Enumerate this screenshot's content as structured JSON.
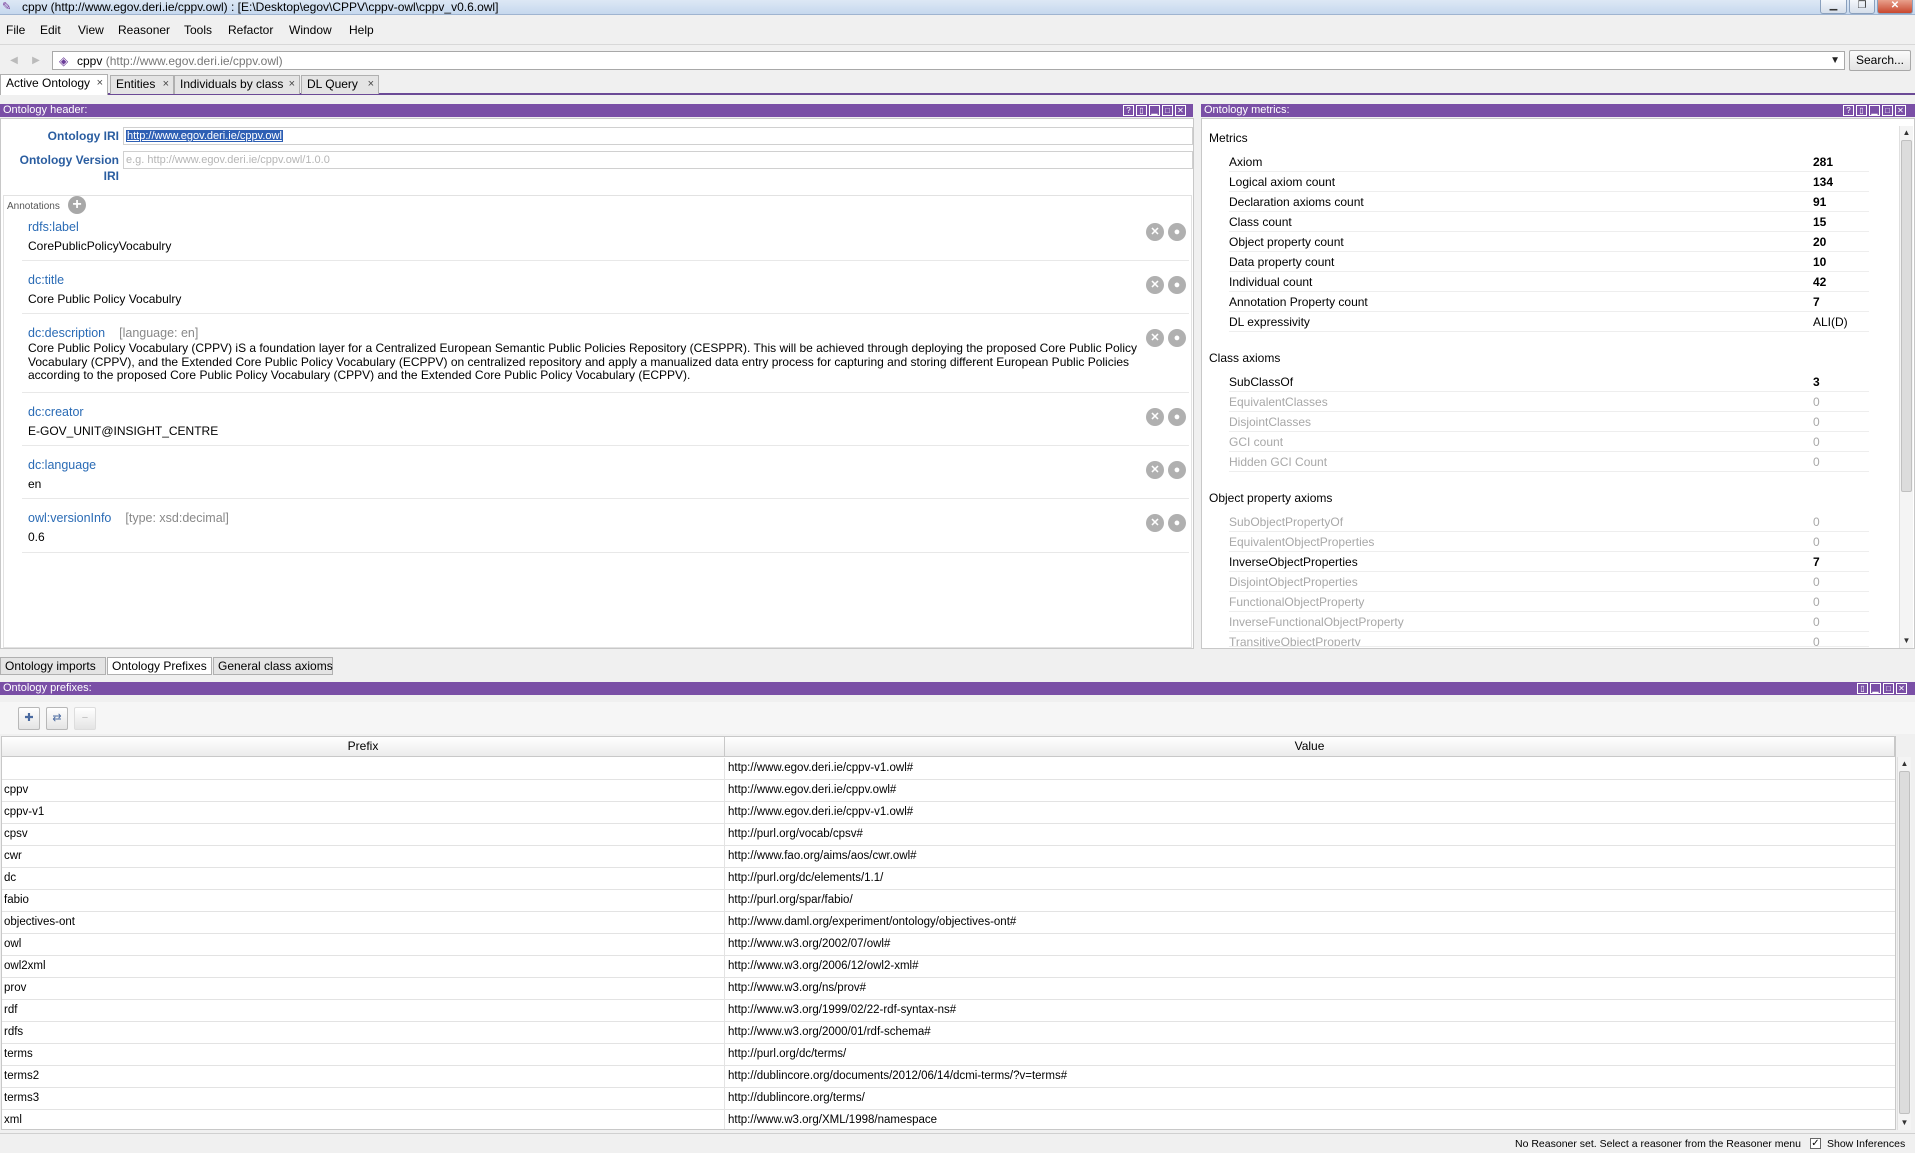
{
  "window": {
    "title": "cppv (http://www.egov.deri.ie/cppv.owl)  : [E:\\Desktop\\egov\\CPPV\\cppv-owl\\cppv_v0.6.owl]",
    "app_icon": "protege-icon",
    "controls": [
      "minimize",
      "maximize",
      "close"
    ]
  },
  "menu": [
    "File",
    "Edit",
    "View",
    "Reasoner",
    "Tools",
    "Refactor",
    "Window",
    "Help"
  ],
  "address": {
    "name": "cppv",
    "iri": "(http://www.egov.deri.ie/cppv.owl)",
    "search_label": "Search..."
  },
  "tabs": [
    {
      "label": "Active Ontology",
      "active": true
    },
    {
      "label": "Entities",
      "active": false
    },
    {
      "label": "Individuals by class",
      "active": false
    },
    {
      "label": "DL Query",
      "active": false
    }
  ],
  "header_panel": {
    "title": "Ontology header:",
    "iri_label": "Ontology IRI",
    "iri_value": "http://www.egov.deri.ie/cppv.owl",
    "version_label": "Ontology Version IRI",
    "version_placeholder": "e.g. http://www.egov.deri.ie/cppv.owl/1.0.0",
    "annotations_title": "Annotations",
    "annotations": [
      {
        "property": "rdfs:label",
        "qualifier": "",
        "value": "CorePublicPolicyVocabulry"
      },
      {
        "property": "dc:title",
        "qualifier": "",
        "value": "Core Public Policy Vocabulry"
      },
      {
        "property": "dc:description",
        "qualifier": "[language: en]",
        "value": "Core Public Policy Vocabulary (CPPV) iS a foundation layer for a Centralized European Semantic Public Policies Repository (CESPPR). This will be achieved through deploying the proposed Core Public Policy Vocabulary (CPPV), and the Extended Core Public Policy Vocabulary (ECPPV) on centralized repository and apply a manualized data entry process for capturing and storing different European Public Policies according to the proposed Core Public Policy Vocabulary (CPPV) and the Extended Core Public Policy Vocabulary (ECPPV)."
      },
      {
        "property": "dc:creator",
        "qualifier": "",
        "value": "E-GOV_UNIT@INSIGHT_CENTRE"
      },
      {
        "property": "dc:language",
        "qualifier": "",
        "value": "en"
      },
      {
        "property": "owl:versionInfo",
        "qualifier": "[type: xsd:decimal]",
        "value": "0.6"
      }
    ]
  },
  "metrics_panel": {
    "title": "Ontology metrics:",
    "sections": [
      {
        "title": "Metrics",
        "rows": [
          {
            "label": "Axiom",
            "value": "281",
            "dim": false
          },
          {
            "label": "Logical axiom count",
            "value": "134",
            "dim": false
          },
          {
            "label": "Declaration axioms count",
            "value": "91",
            "dim": false
          },
          {
            "label": "Class count",
            "value": "15",
            "dim": false
          },
          {
            "label": "Object property count",
            "value": "20",
            "dim": false
          },
          {
            "label": "Data property count",
            "value": "10",
            "dim": false
          },
          {
            "label": "Individual count",
            "value": "42",
            "dim": false
          },
          {
            "label": "Annotation Property count",
            "value": "7",
            "dim": false
          },
          {
            "label": "DL expressivity",
            "value": "ALI(D)",
            "dim": false,
            "plain": true
          }
        ]
      },
      {
        "title": "Class axioms",
        "rows": [
          {
            "label": "SubClassOf",
            "value": "3",
            "dim": false
          },
          {
            "label": "EquivalentClasses",
            "value": "0",
            "dim": true
          },
          {
            "label": "DisjointClasses",
            "value": "0",
            "dim": true
          },
          {
            "label": "GCI count",
            "value": "0",
            "dim": true
          },
          {
            "label": "Hidden GCI Count",
            "value": "0",
            "dim": true
          }
        ]
      },
      {
        "title": "Object property axioms",
        "rows": [
          {
            "label": "SubObjectPropertyOf",
            "value": "0",
            "dim": true
          },
          {
            "label": "EquivalentObjectProperties",
            "value": "0",
            "dim": true
          },
          {
            "label": "InverseObjectProperties",
            "value": "7",
            "dim": false
          },
          {
            "label": "DisjointObjectProperties",
            "value": "0",
            "dim": true
          },
          {
            "label": "FunctionalObjectProperty",
            "value": "0",
            "dim": true
          },
          {
            "label": "InverseFunctionalObjectProperty",
            "value": "0",
            "dim": true
          },
          {
            "label": "TransitiveObjectProperty",
            "value": "0",
            "dim": true
          }
        ]
      }
    ]
  },
  "subtabs": [
    {
      "label": "Ontology imports",
      "active": false
    },
    {
      "label": "Ontology Prefixes",
      "active": true
    },
    {
      "label": "General class axioms",
      "active": false
    }
  ],
  "prefix_panel": {
    "title": "Ontology prefixes:",
    "columns": [
      "Prefix",
      "Value"
    ],
    "rows": [
      [
        "",
        "http://www.egov.deri.ie/cppv-v1.owl#"
      ],
      [
        "cppv",
        "http://www.egov.deri.ie/cppv.owl#"
      ],
      [
        "cppv-v1",
        "http://www.egov.deri.ie/cppv-v1.owl#"
      ],
      [
        "cpsv",
        "http://purl.org/vocab/cpsv#"
      ],
      [
        "cwr",
        "http://www.fao.org/aims/aos/cwr.owl#"
      ],
      [
        "dc",
        "http://purl.org/dc/elements/1.1/"
      ],
      [
        "fabio",
        "http://purl.org/spar/fabio/"
      ],
      [
        "objectives-ont",
        "http://www.daml.org/experiment/ontology/objectives-ont#"
      ],
      [
        "owl",
        "http://www.w3.org/2002/07/owl#"
      ],
      [
        "owl2xml",
        "http://www.w3.org/2006/12/owl2-xml#"
      ],
      [
        "prov",
        "http://www.w3.org/ns/prov#"
      ],
      [
        "rdf",
        "http://www.w3.org/1999/02/22-rdf-syntax-ns#"
      ],
      [
        "rdfs",
        "http://www.w3.org/2000/01/rdf-schema#"
      ],
      [
        "terms",
        "http://purl.org/dc/terms/"
      ],
      [
        "terms2",
        "http://dublincore.org/documents/2012/06/14/dcmi-terms/?v=terms#"
      ],
      [
        "terms3",
        "http://dublincore.org/terms/"
      ],
      [
        "xml",
        "http://www.w3.org/XML/1998/namespace"
      ]
    ]
  },
  "status": {
    "text": "No Reasoner set. Select a reasoner from the Reasoner menu",
    "show_inferences_label": "Show Inferences",
    "show_inferences_checked": true
  }
}
